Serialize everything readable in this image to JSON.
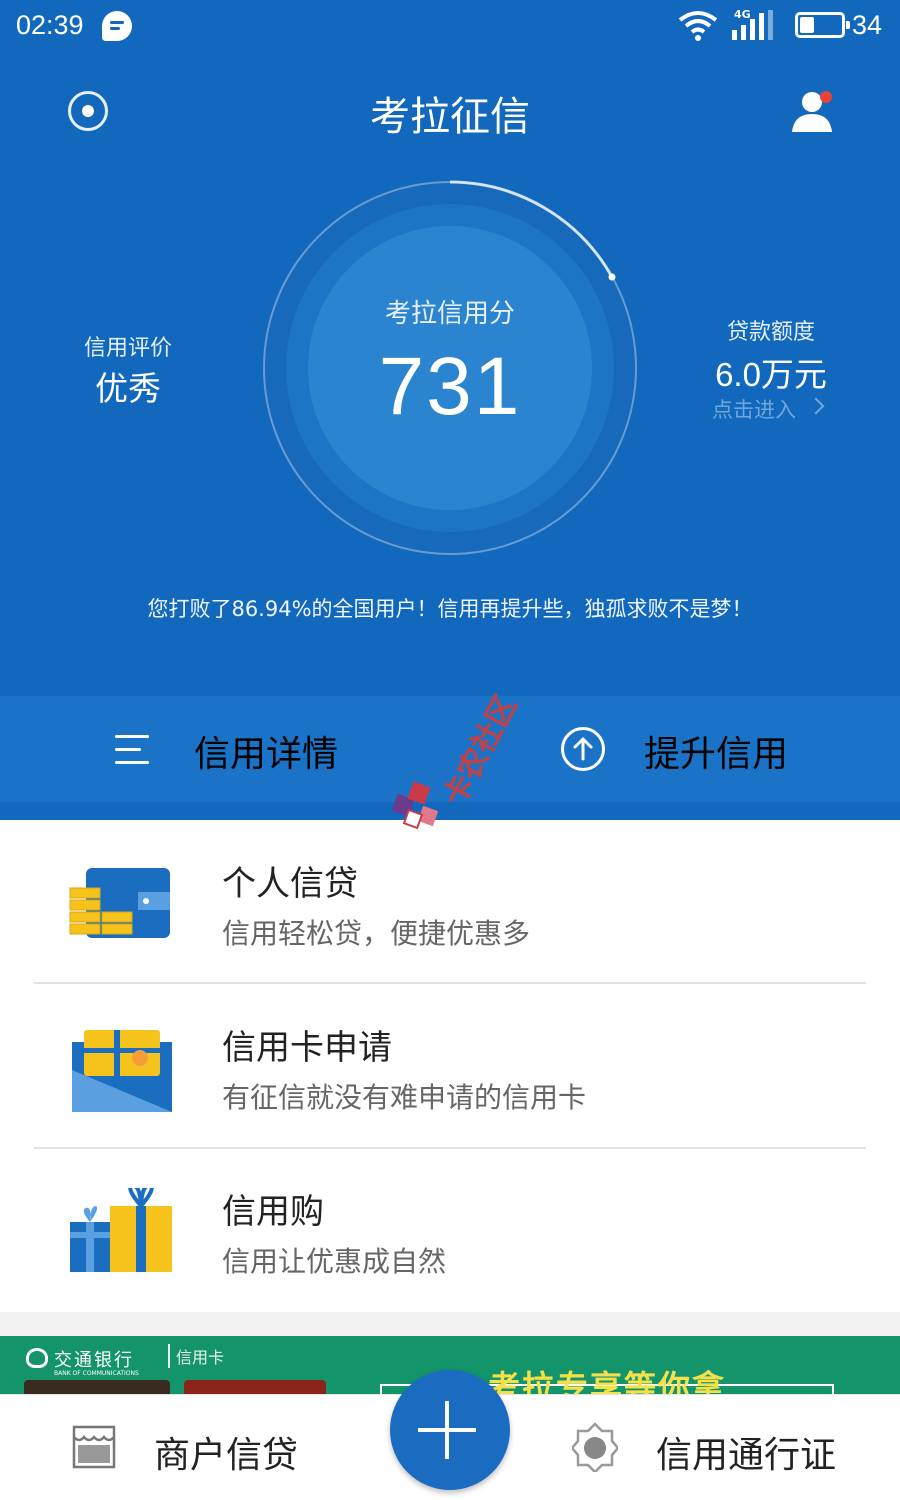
{
  "status_bar": {
    "time": "02:39",
    "network": "4G",
    "battery": "34",
    "battery_level": 0.34
  },
  "header": {
    "title": "考拉征信"
  },
  "score": {
    "title": "考拉信用分",
    "value": "731"
  },
  "rating": {
    "label": "信用评价",
    "value": "优秀"
  },
  "loan": {
    "label": "贷款额度",
    "value": "6.0万元",
    "link": "点击进入"
  },
  "beat_text": "您打败了86.94%的全国用户！信用再提升些，独孤求败不是梦！",
  "actions": {
    "detail": "信用详情",
    "raise": "提升信用"
  },
  "watermark": "卡农社区",
  "services": [
    {
      "title": "个人信贷",
      "subtitle": "信用轻松贷，便捷优惠多",
      "icon": "wallet-icon"
    },
    {
      "title": "信用卡申请",
      "subtitle": "有征信就没有难申请的信用卡",
      "icon": "card-envelope-icon"
    },
    {
      "title": "信用购",
      "subtitle": "信用让优惠成自然",
      "icon": "gift-icon"
    }
  ],
  "banner": {
    "bank": "交通银行",
    "bank_en": "BANK OF COMMUNICATIONS",
    "card_label": "信用卡",
    "slogan": "考拉专享等你拿"
  },
  "bottom_nav": {
    "merchant": "商户信贷",
    "pass": "信用通行证"
  },
  "colors": {
    "primary": "#1268bd",
    "action_bar": "#1a73c6",
    "banner": "#13946b",
    "accent_yellow": "#f6c21c"
  }
}
